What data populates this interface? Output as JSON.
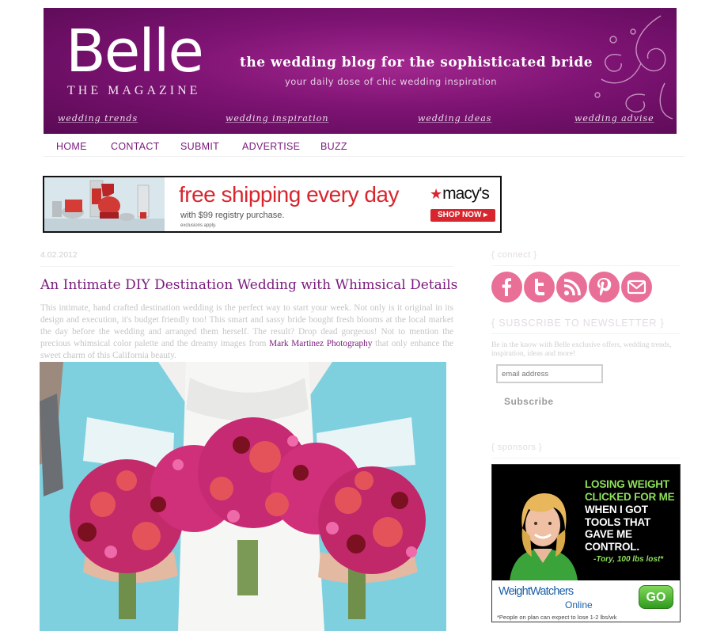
{
  "header": {
    "logo_main": "Belle",
    "logo_sub": "THE MAGAZINE",
    "tagline": "the wedding blog for the sophisticated bride",
    "subtagline": "your daily dose of chic wedding inspiration",
    "links": [
      "wedding trends",
      "wedding inspiration",
      "wedding ideas",
      "wedding advise"
    ]
  },
  "nav": {
    "items": [
      "HOME",
      "CONTACT",
      "SUBMIT",
      "ADVERTISE",
      "BUZZ"
    ]
  },
  "ad_banner": {
    "headline": "free shipping every day",
    "sub": "with $99 registry purchase.",
    "fine_print": "exclusions apply.",
    "brand": "macy's",
    "cta": "SHOP NOW ▸"
  },
  "post": {
    "date": "4.02.2012",
    "title": "An Intimate DIY Destination Wedding with Whimsical Details",
    "body_before_link": "This intimate, hand crafted destination wedding is the perfect way to start your week. Not only is it original in its design and execution, it's budget friendly too!  This smart and sassy bride bought fresh blooms at the local market the day before the wedding and arranged them herself. The result? Drop dead gorgeous! Not to mention the precious whimsical color palette and the dreamy images from ",
    "link_text": "Mark Martinez Photography",
    "body_after_link": " that only enhance the sweet charm of this California beauty."
  },
  "sidebar": {
    "connect_heading": "{ connect }",
    "social": [
      "facebook",
      "twitter",
      "rss",
      "pinterest",
      "email"
    ],
    "newsletter_heading": "{ SUBSCRIBE TO NEWSLETTER }",
    "newsletter_desc": "Be in the know with Belle exclusive offers, wedding trends, inspiration, ideas and more!",
    "email_placeholder": "email address",
    "subscribe_label": "Subscribe",
    "sponsors_heading": "{ sponsors }"
  },
  "sponsor_ad": {
    "green_lines": "LOSING WEIGHT CLICKED FOR ME",
    "white_lines": "WHEN I GOT TOOLS THAT GAVE ME CONTROL.",
    "quote": "-Tory, 100 lbs lost*",
    "brand": "WeightWatchers",
    "brand_sub": "Online",
    "cta": "GO",
    "disclaimer": "*People on plan can expect to lose 1-2 lbs/wk"
  },
  "colors": {
    "brand_purple": "#7a1a7c",
    "social_pink": "#e96f96",
    "macys_red": "#d8262f",
    "ww_green": "#8ee05a"
  }
}
